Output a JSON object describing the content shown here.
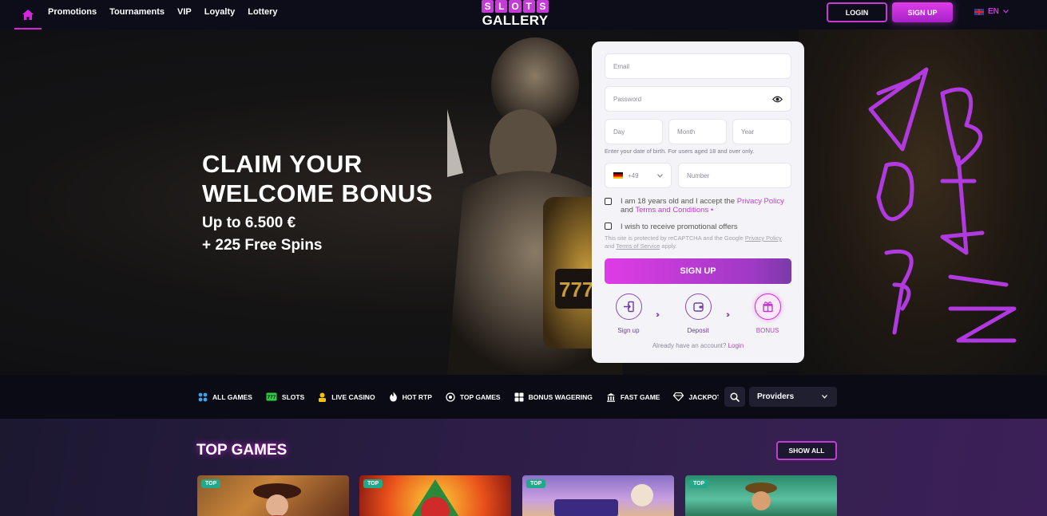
{
  "header": {
    "nav": [
      "Promotions",
      "Tournaments",
      "VIP",
      "Loyalty",
      "Lottery"
    ],
    "logo_top": [
      "S",
      "L",
      "O",
      "T",
      "S"
    ],
    "logo_bottom": "GALLERY",
    "login_label": "LOGIN",
    "signup_label": "SIGN UP",
    "language": "EN"
  },
  "hero": {
    "title_line1": "CLAIM YOUR",
    "title_line2": "WELCOME BONUS",
    "subtitle1": "Up to 6.500 €",
    "subtitle2": "+ 225 Free Spins"
  },
  "form": {
    "email_placeholder": "Email",
    "password_placeholder": "Password",
    "day_placeholder": "Day",
    "month_placeholder": "Month",
    "year_placeholder": "Year",
    "dob_hint": "Enter your date of birth. For users aged 18 and over only.",
    "phone_code": "+49",
    "number_placeholder": "Number",
    "terms_text_1": "I am 18 years old and I accept the ",
    "terms_link_privacy": "Privacy Policy",
    "terms_text_and": " and ",
    "terms_link_terms": "Terms and Conditions",
    "terms_required": " •",
    "promo_label": "I wish to receive promotional offers",
    "recaptcha_1": "This site is protected by reCAPTCHA and the Google ",
    "recaptcha_privacy": "Privacy Policy",
    "recaptcha_and": " and ",
    "recaptcha_terms": "Terms of Service",
    "recaptcha_2": " apply.",
    "signup_button": "SIGN UP",
    "steps": [
      "Sign up",
      "Deposit",
      "BONUS"
    ],
    "already_text": "Already have an account? ",
    "already_link": "Login"
  },
  "categories": [
    "ALL GAMES",
    "SLOTS",
    "LIVE CASINO",
    "HOT RTP",
    "TOP GAMES",
    "BONUS WAGERING",
    "FAST GAME",
    "JACKPOT"
  ],
  "providers_label": "Providers",
  "games": {
    "title": "TOP GAMES",
    "show_all": "SHOW ALL",
    "badges": [
      "TOP",
      "TOP",
      "TOP",
      "TOP"
    ]
  },
  "colors": {
    "accent": "#d726e0",
    "brand": "#c43bd6",
    "badge": "#22a88a"
  }
}
